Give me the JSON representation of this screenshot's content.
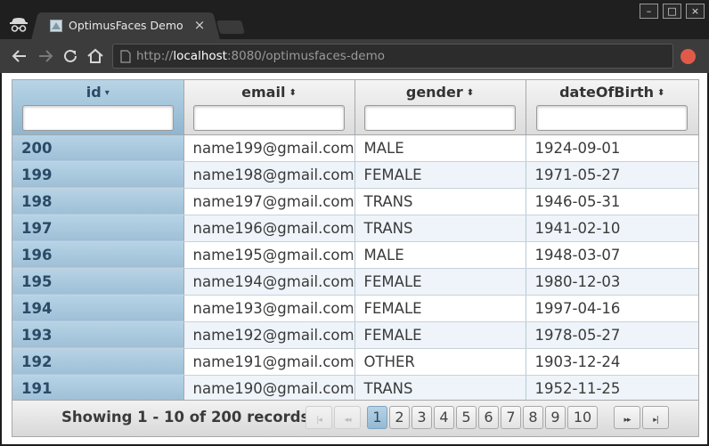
{
  "browser": {
    "tab_title": "OptimusFaces Demo",
    "tab_close": "×",
    "url_scheme": "http://",
    "url_host": "localhost",
    "url_rest": ":8080/optimusfaces-demo",
    "window_minimize": "–",
    "window_maximize": "□",
    "window_close": "×"
  },
  "table": {
    "columns": [
      {
        "label": "id",
        "sort": "descending",
        "sort_glyph": "▾",
        "active": true
      },
      {
        "label": "email",
        "sort": "sortable",
        "sort_glyph": "⬍",
        "active": false
      },
      {
        "label": "gender",
        "sort": "sortable",
        "sort_glyph": "⬍",
        "active": false
      },
      {
        "label": "dateOfBirth",
        "sort": "sortable",
        "sort_glyph": "⬍",
        "active": false
      }
    ],
    "rows": [
      {
        "id": "200",
        "email": "name199@gmail.com",
        "gender": "MALE",
        "dateOfBirth": "1924-09-01"
      },
      {
        "id": "199",
        "email": "name198@gmail.com",
        "gender": "FEMALE",
        "dateOfBirth": "1971-05-27"
      },
      {
        "id": "198",
        "email": "name197@gmail.com",
        "gender": "TRANS",
        "dateOfBirth": "1946-05-31"
      },
      {
        "id": "197",
        "email": "name196@gmail.com",
        "gender": "TRANS",
        "dateOfBirth": "1941-02-10"
      },
      {
        "id": "196",
        "email": "name195@gmail.com",
        "gender": "MALE",
        "dateOfBirth": "1948-03-07"
      },
      {
        "id": "195",
        "email": "name194@gmail.com",
        "gender": "FEMALE",
        "dateOfBirth": "1980-12-03"
      },
      {
        "id": "194",
        "email": "name193@gmail.com",
        "gender": "FEMALE",
        "dateOfBirth": "1997-04-16"
      },
      {
        "id": "193",
        "email": "name192@gmail.com",
        "gender": "FEMALE",
        "dateOfBirth": "1978-05-27"
      },
      {
        "id": "192",
        "email": "name191@gmail.com",
        "gender": "OTHER",
        "dateOfBirth": "1903-12-24"
      },
      {
        "id": "191",
        "email": "name190@gmail.com",
        "gender": "TRANS",
        "dateOfBirth": "1952-11-25"
      }
    ]
  },
  "paginator": {
    "records_text": "Showing 1 - 10 of 200 records",
    "first_glyph": "|◂",
    "prev_glyph": "◂◂",
    "next_glyph": "▸▸",
    "last_glyph": "▸|",
    "pages": [
      "1",
      "2",
      "3",
      "4",
      "5",
      "6",
      "7",
      "8",
      "9",
      "10"
    ],
    "current_page": "1"
  },
  "colors": {
    "header_sorted": "#8fb6d0",
    "id_column": "#9dbfd6",
    "active_page": "#94b9d3",
    "alt_row": "#eef4f9"
  }
}
